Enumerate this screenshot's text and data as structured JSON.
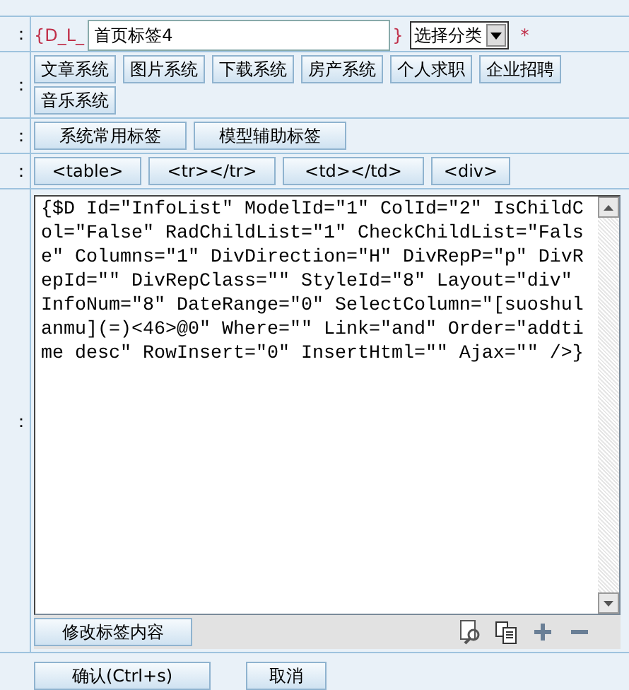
{
  "name_row": {
    "label": "：",
    "prefix": "{D_L_",
    "value": "首页标签4",
    "suffix": "}",
    "category": "选择分类",
    "required_mark": "*"
  },
  "system_row": {
    "label": "：",
    "buttons": [
      "文章系统",
      "图片系统",
      "下载系统",
      "房产系统",
      "个人求职",
      "企业招聘",
      "音乐系统"
    ]
  },
  "tag_row": {
    "label": "：",
    "buttons": [
      "系统常用标签",
      "模型辅助标签"
    ]
  },
  "code_row": {
    "label": "：",
    "buttons": [
      "<table>",
      "<tr></tr>",
      "<td></td>",
      "<div>"
    ]
  },
  "content_row": {
    "label": "：",
    "code": "{$D Id=\"InfoList\" ModelId=\"1\" ColId=\"2\" IsChildCol=\"False\" RadChildList=\"1\" CheckChildList=\"False\" Columns=\"1\" DivDirection=\"H\" DivRepP=\"p\" DivRepId=\"\" DivRepClass=\"\" StyleId=\"8\" Layout=\"div\" InfoNum=\"8\" DateRange=\"0\" SelectColumn=\"[suoshulanmu](=)<46>@0\" Where=\"\" Link=\"and\" Order=\"addtime desc\" RowInsert=\"0\" InsertHtml=\"\" Ajax=\"\" />}",
    "edit_button": "修改标签内容"
  },
  "footer_buttons": [
    "确认(Ctrl+s)",
    "取消"
  ]
}
